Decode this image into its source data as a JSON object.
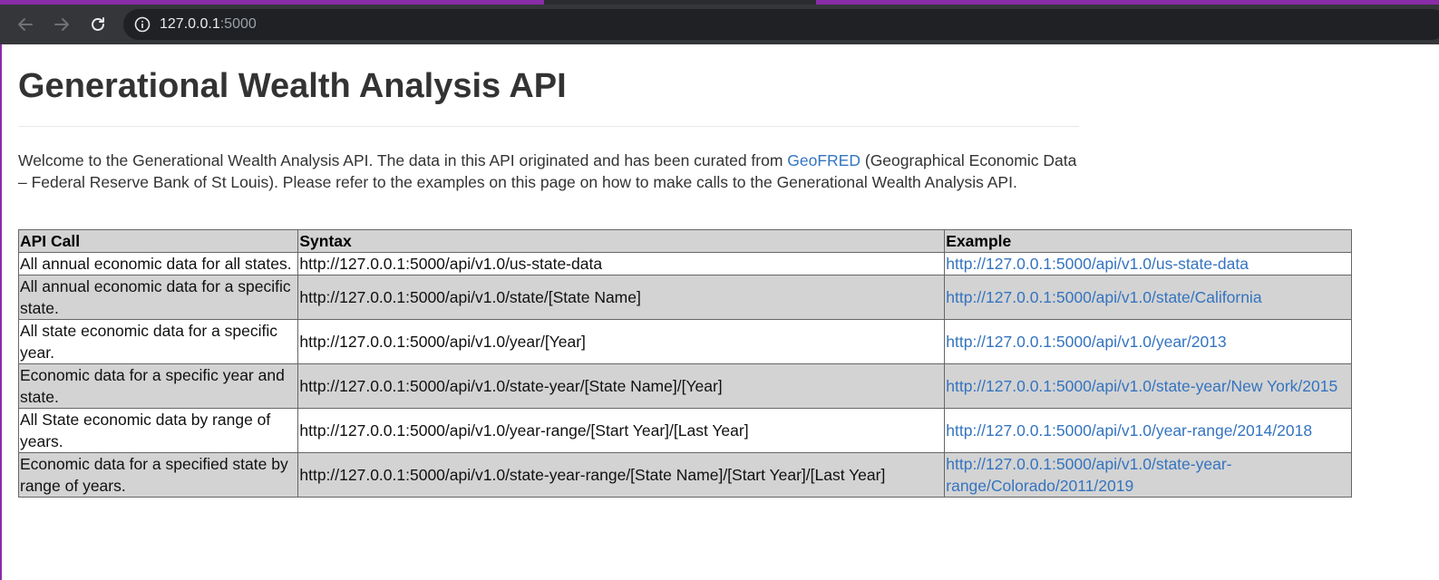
{
  "browser": {
    "url_host": "127.0.0.1",
    "url_port": ":5000"
  },
  "page": {
    "title": "Generational Wealth Analysis API",
    "intro_before": "Welcome to the Generational Wealth Analysis API. The data in this API originated and has been curated from ",
    "intro_link": "GeoFRED",
    "intro_after": " (Geographical Economic Data – Federal Reserve Bank of St Louis). Please refer to the examples on this page on how to make calls to the Generational Wealth Analysis API."
  },
  "table": {
    "headers": [
      "API Call",
      "Syntax",
      "Example"
    ],
    "rows": [
      {
        "call": "All annual economic data for all states.",
        "syntax": "http://127.0.0.1:5000/api/v1.0/us-state-data",
        "example": "http://127.0.0.1:5000/api/v1.0/us-state-data"
      },
      {
        "call": "All annual economic data for a specific state.",
        "syntax": "http://127.0.0.1:5000/api/v1.0/state/[State Name]",
        "example": "http://127.0.0.1:5000/api/v1.0/state/California"
      },
      {
        "call": "All state economic data for a specific year.",
        "syntax": "http://127.0.0.1:5000/api/v1.0/year/[Year]",
        "example": "http://127.0.0.1:5000/api/v1.0/year/2013"
      },
      {
        "call": "Economic data for a specific year and state.",
        "syntax": "http://127.0.0.1:5000/api/v1.0/state-year/[State Name]/[Year]",
        "example": "http://127.0.0.1:5000/api/v1.0/state-year/New York/2015"
      },
      {
        "call": "All State economic data by range of years.",
        "syntax": "http://127.0.0.1:5000/api/v1.0/year-range/[Start Year]/[Last Year]",
        "example": "http://127.0.0.1:5000/api/v1.0/year-range/2014/2018"
      },
      {
        "call": "Economic data for a specified state by range of years.",
        "syntax": "http://127.0.0.1:5000/api/v1.0/state-year-range/[State Name]/[Start Year]/[Last Year]",
        "example": "http://127.0.0.1:5000/api/v1.0/state-year-range/Colorado/2011/2019"
      }
    ]
  },
  "colors": {
    "accent": "#8a2ca8",
    "link": "#3474c0",
    "row_shade": "#d3d3d3",
    "toolbar": "#35363a"
  }
}
